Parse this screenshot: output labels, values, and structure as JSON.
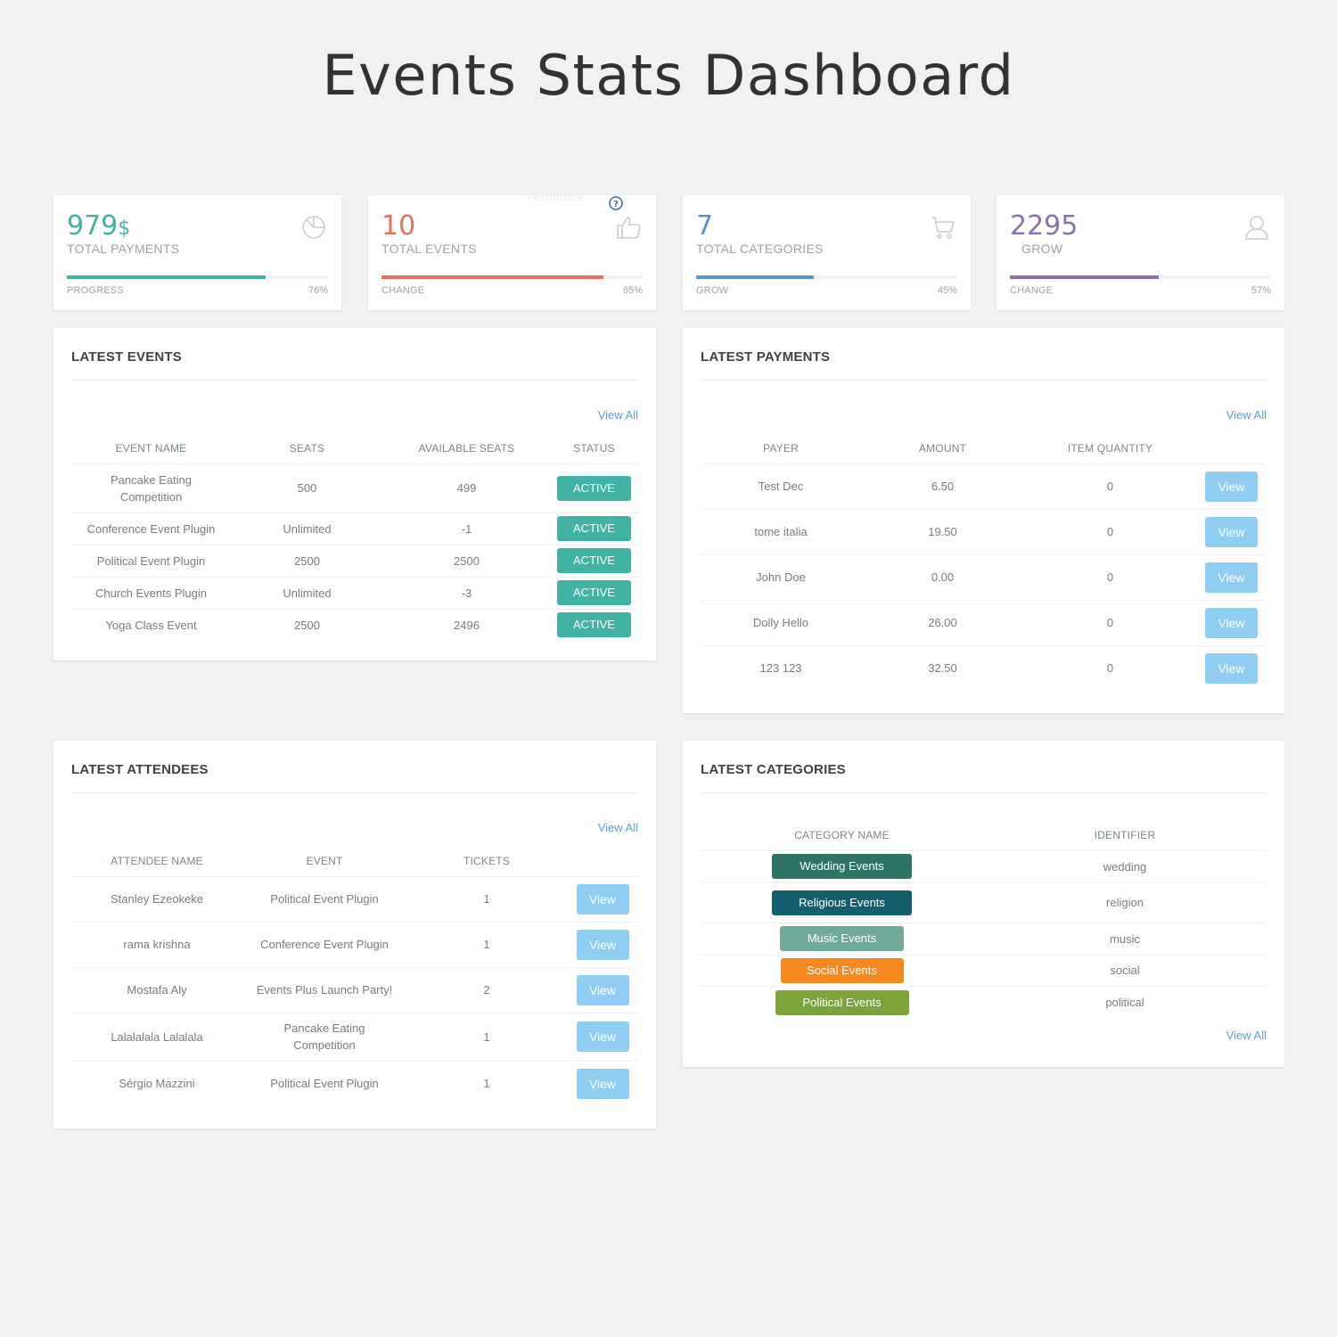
{
  "page_title": "Events Stats Dashboard",
  "stats": [
    {
      "value": "979",
      "suffix": "$",
      "label": "TOTAL PAYMENTS",
      "sub": "PROGRESS",
      "pct_text": "76%",
      "progress": 0.76,
      "color": "#41b3a3",
      "icon": "pie-chart-icon"
    },
    {
      "value": "10",
      "suffix": "",
      "label": "TOTAL EVENTS",
      "sub": "CHANGE",
      "pct_text": "85%",
      "progress": 0.85,
      "color": "#e8705a",
      "icon": "thumbs-up-icon",
      "tooltip": "Performance",
      "help_icon": "question-icon"
    },
    {
      "value": "7",
      "suffix": "",
      "label": "TOTAL CATEGORIES",
      "sub": "GROW",
      "pct_text": "45%",
      "progress": 0.45,
      "color": "#5a91c8",
      "icon": "cart-icon"
    },
    {
      "value": "2295",
      "suffix": "",
      "label": "GROW",
      "sub": "CHANGE",
      "pct_text": "57%",
      "progress": 0.57,
      "color": "#8a72a8",
      "icon": "user-icon"
    }
  ],
  "latest_events": {
    "title": "LATEST EVENTS",
    "view_all": "View All",
    "columns": [
      "EVENT NAME",
      "SEATS",
      "AVAILABLE SEATS",
      "STATUS"
    ],
    "rows": [
      {
        "name": "Pancake Eating Competition",
        "seats": "500",
        "available": "499",
        "status": "ACTIVE"
      },
      {
        "name": "Conference Event Plugin",
        "seats": "Unlimited",
        "available": "-1",
        "status": "ACTIVE"
      },
      {
        "name": "Political Event Plugin",
        "seats": "2500",
        "available": "2500",
        "status": "ACTIVE"
      },
      {
        "name": "Church Events Plugin",
        "seats": "Unlimited",
        "available": "-3",
        "status": "ACTIVE"
      },
      {
        "name": "Yoga Class Event",
        "seats": "2500",
        "available": "2496",
        "status": "ACTIVE"
      }
    ]
  },
  "latest_payments": {
    "title": "LATEST PAYMENTS",
    "view_all": "View All",
    "columns": [
      "PAYER",
      "AMOUNT",
      "ITEM QUANTITY",
      ""
    ],
    "button_label": "View",
    "rows": [
      {
        "payer": "Test Dec",
        "amount": "6.50",
        "qty": "0"
      },
      {
        "payer": "tome italia",
        "amount": "19.50",
        "qty": "0"
      },
      {
        "payer": "John Doe",
        "amount": "0.00",
        "qty": "0"
      },
      {
        "payer": "Dolly Hello",
        "amount": "26.00",
        "qty": "0"
      },
      {
        "payer": "123 123",
        "amount": "32.50",
        "qty": "0"
      }
    ]
  },
  "latest_attendees": {
    "title": "LATEST ATTENDEES",
    "view_all": "View All",
    "columns": [
      "ATTENDEE NAME",
      "EVENT",
      "TICKETS",
      ""
    ],
    "button_label": "View",
    "rows": [
      {
        "name": "Stanley Ezeokeke",
        "event": "Political Event Plugin",
        "tickets": "1"
      },
      {
        "name": "rama krishna",
        "event": "Conference Event Plugin",
        "tickets": "1"
      },
      {
        "name": "Mostafa Aly",
        "event": "Events Plus Launch Party!",
        "tickets": "2"
      },
      {
        "name": "Lalalalala Lalalala",
        "event": "Pancake Eating Competition",
        "tickets": "1"
      },
      {
        "name": "Sérgio Mazzini",
        "event": "Political Event Plugin",
        "tickets": "1"
      }
    ]
  },
  "latest_categories": {
    "title": "LATEST CATEGORIES",
    "view_all": "View All",
    "columns": [
      "CATEGORY NAME",
      "IDENTIFIER"
    ],
    "rows": [
      {
        "name": "Wedding Events",
        "identifier": "wedding",
        "color": "#2e7365"
      },
      {
        "name": "Religious Events",
        "identifier": "religion",
        "color": "#135f6e"
      },
      {
        "name": "Music Events",
        "identifier": "music",
        "color": "#6fab9d"
      },
      {
        "name": "Social Events",
        "identifier": "social",
        "color": "#f5891f"
      },
      {
        "name": "Political Events",
        "identifier": "political",
        "color": "#7ca23a"
      }
    ]
  }
}
